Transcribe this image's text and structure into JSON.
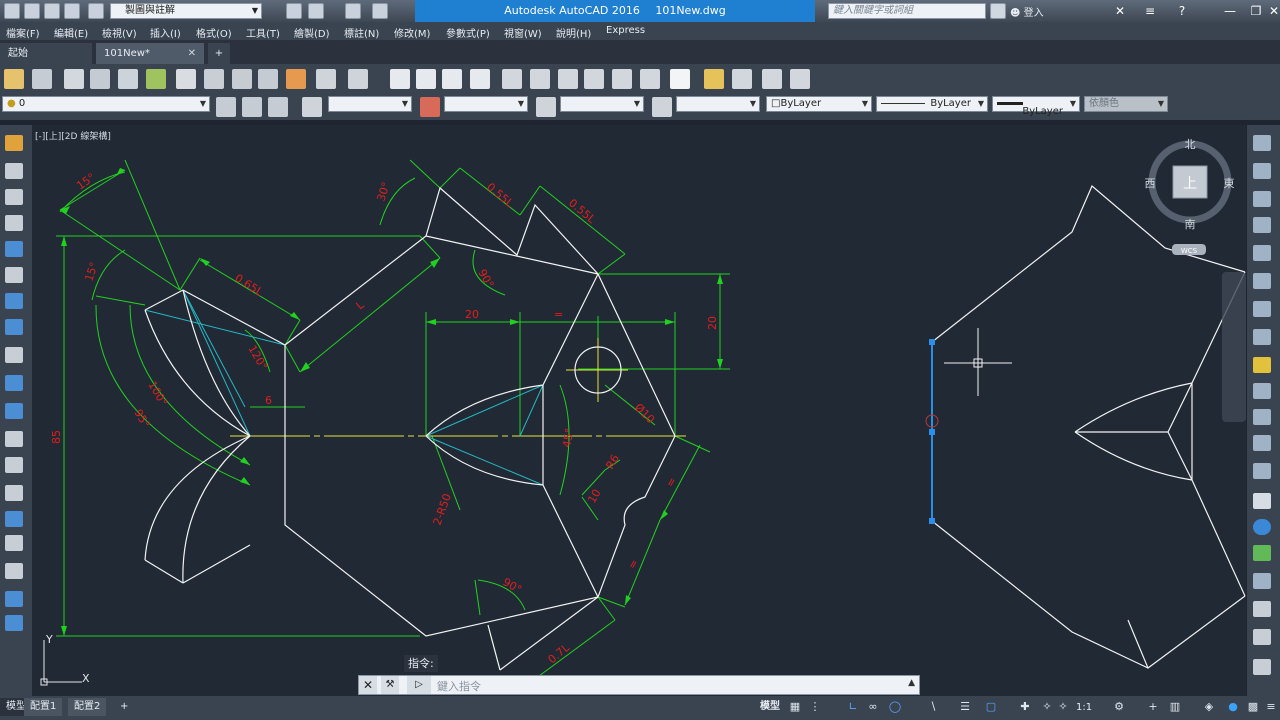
{
  "window": {
    "app_name": "Autodesk AutoCAD 2016",
    "file_name": "101New.dwg",
    "workspace": "製圖與註解",
    "search_placeholder": "鍵入關鍵字或詞組",
    "login_label": "登入"
  },
  "menu": [
    "檔案(F)",
    "編輯(E)",
    "檢視(V)",
    "插入(I)",
    "格式(O)",
    "工具(T)",
    "繪製(D)",
    "標註(N)",
    "修改(M)",
    "參數式(P)",
    "視窗(W)",
    "說明(H)",
    "Express"
  ],
  "tabs": {
    "start": "起始",
    "document": "101New*"
  },
  "properties": {
    "layer": "0",
    "color": "ByLayer",
    "linetype": "ByLayer",
    "lineweight": "ByLayer",
    "plotstyle": "依顏色"
  },
  "viewport": {
    "label": "[-][上][2D 線架構]"
  },
  "viewcube": {
    "top": "上",
    "north": "北",
    "south": "南",
    "east": "東",
    "west": "西",
    "ucs": "WCS"
  },
  "ucs_icon": {
    "x": "X",
    "y": "Y"
  },
  "dimensions": {
    "a15_top": "15°",
    "a15_left": "15°",
    "a30": "30°",
    "l055_1": "0.55L",
    "l055_2": "0.55L",
    "l065": "0.65L",
    "l_upper": "L",
    "a90_upper": "90°",
    "a120": "120°",
    "r100": "100°",
    "r95": "95°",
    "d85": "85",
    "d6": "6",
    "d20_h": "20",
    "eq_h": "=",
    "d20_v": "20",
    "dia10": "Ø10",
    "a45": "45°",
    "r6": "R6",
    "d10": "10",
    "eq_d1": "=",
    "eq_d2": "=",
    "r50": "2-R50",
    "a90_lower": "90°",
    "l07": "0.7L"
  },
  "command": {
    "prompt": "指令:",
    "placeholder": "鍵入指令"
  },
  "layout_tabs": {
    "model": "模型",
    "layout1": "配置1",
    "layout2": "配置2"
  },
  "status": {
    "model_space": "模型",
    "scale": "1:1"
  },
  "colors": {
    "canvas": "#212935",
    "dimension": "#22d11f",
    "dim_text": "#e0201c",
    "geometry": "#f2f2f2",
    "centerline": "#e4e43a",
    "construction": "#26b8c4",
    "selection": "#2b8ee8",
    "title_bar_accent": "#1f7fd1"
  }
}
